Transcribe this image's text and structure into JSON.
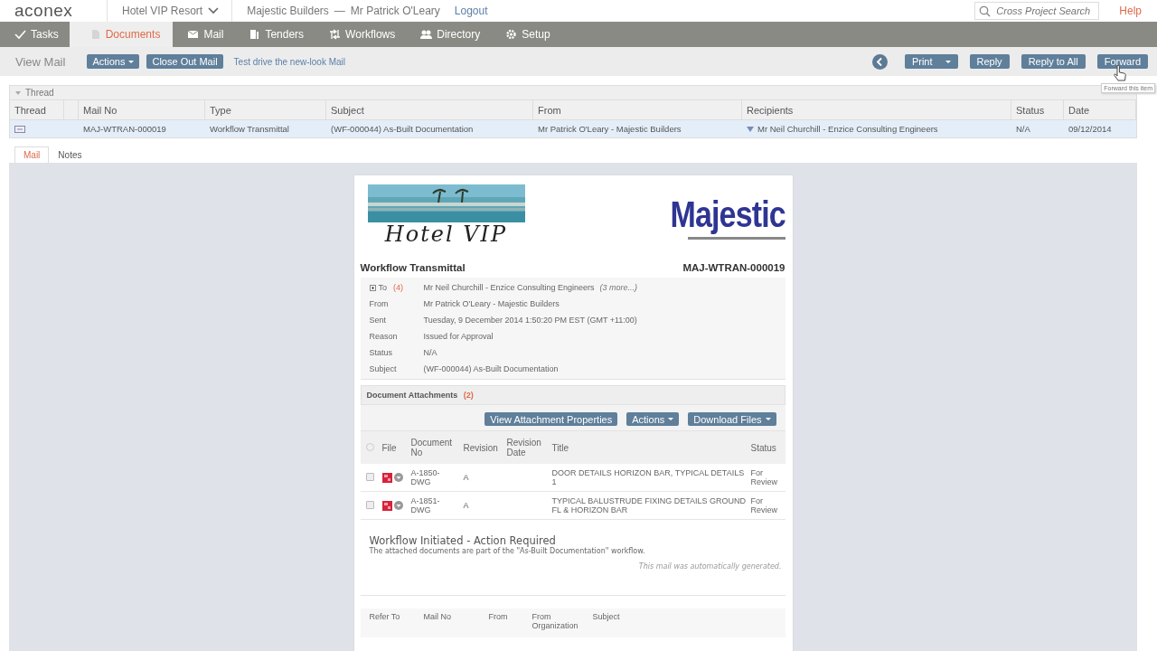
{
  "header": {
    "logo": "aconex",
    "project": "Hotel VIP Resort",
    "organization": "Majestic Builders",
    "separator": "—",
    "user": "Mr Patrick O'Leary",
    "logout": "Logout",
    "search": {
      "placeholder": "Cross Project Search"
    },
    "help": "Help"
  },
  "nav": [
    {
      "label": "Tasks",
      "selected": false
    },
    {
      "label": "Documents",
      "selected": true
    },
    {
      "label": "Mail",
      "selected": false
    },
    {
      "label": "Tenders",
      "selected": false
    },
    {
      "label": "Workflows",
      "selected": false
    },
    {
      "label": "Directory",
      "selected": false
    },
    {
      "label": "Setup",
      "selected": false
    }
  ],
  "toolbar": {
    "title": "View Mail",
    "left_buttons": [
      {
        "label": "Actions",
        "dropdown": true
      },
      {
        "label": "Close Out Mail",
        "dropdown": false
      }
    ],
    "link": "Test drive the new-look Mail",
    "right_buttons": [
      {
        "label": "Print",
        "dropdown": true
      },
      {
        "label": "Reply",
        "dropdown": false
      },
      {
        "label": "Reply to All",
        "dropdown": false
      },
      {
        "label": "Forward",
        "dropdown": false
      }
    ],
    "tooltip": "Forward this item"
  },
  "thread": {
    "title": "Thread",
    "expanded": true,
    "columns": [
      "Thread",
      "",
      "Mail No",
      "Type",
      "Subject",
      "From",
      "Recipients",
      "Status",
      "Date"
    ],
    "rows": [
      {
        "selected": true,
        "cells": [
          "",
          "",
          "MAJ-WTRAN-000019",
          "Workflow Transmittal",
          "(WF-000044) As-Built Documentation",
          "Mr Patrick O'Leary - Majestic Builders",
          "Mr Neil Churchill - Enzice Consulting Engineers",
          "N/A",
          "09/12/2014"
        ]
      }
    ]
  },
  "tabs": [
    {
      "label": "Mail",
      "selected": true
    },
    {
      "label": "Notes",
      "selected": false
    }
  ],
  "mail": {
    "logo_left": "Hotel VIP",
    "logo_right": "Majestic",
    "type": "Workflow Transmittal",
    "number": "MAJ-WTRAN-000019",
    "fields": [
      {
        "label": "To",
        "count": "(4)",
        "value": "Mr Neil Churchill - Enzice Consulting Engineers",
        "note": "(3 more...)"
      },
      {
        "label": "From",
        "value": "Mr Patrick O'Leary - Majestic Builders"
      },
      {
        "label": "Sent",
        "value": "Tuesday, 9 December 2014  1:50:20 PM EST (GMT +11:00)"
      },
      {
        "label": "Reason",
        "value": "Issued for Approval"
      },
      {
        "label": "Status",
        "value": "N/A"
      },
      {
        "label": "Subject",
        "value": "(WF-000044) As-Built Documentation"
      }
    ],
    "attachments": {
      "title": "Document Attachments",
      "count": "(2)",
      "select_all_checked": false,
      "buttons": [
        {
          "label": "View Attachment Properties",
          "dropdown": false
        },
        {
          "label": "Actions",
          "dropdown": true
        },
        {
          "label": "Download Files",
          "dropdown": true
        }
      ],
      "columns": [
        "File",
        "Document No",
        "Revision",
        "Revision Date",
        "Title",
        "Status"
      ],
      "rows": [
        {
          "checked": false,
          "document_no": "A-1850-DWG",
          "revision": "A",
          "title": "DOOR DETAILS HORIZON BAR, TYPICAL DETAILS 1",
          "status": "For Review"
        },
        {
          "checked": false,
          "document_no": "A-1851-DWG",
          "revision": "A",
          "title": "TYPICAL BALUSTRUDE FIXING DETAILS GROUND FL & HORIZON BAR",
          "status": "For Review"
        }
      ]
    },
    "heading": "Workflow Initiated - Action Required",
    "text": "The attached documents are part of the \"As-Built Documentation\" workflow.",
    "auto_note": "This mail was automatically generated.",
    "refer_columns": [
      "Refer To",
      "Mail No",
      "From",
      "From Organization",
      "Subject"
    ]
  }
}
